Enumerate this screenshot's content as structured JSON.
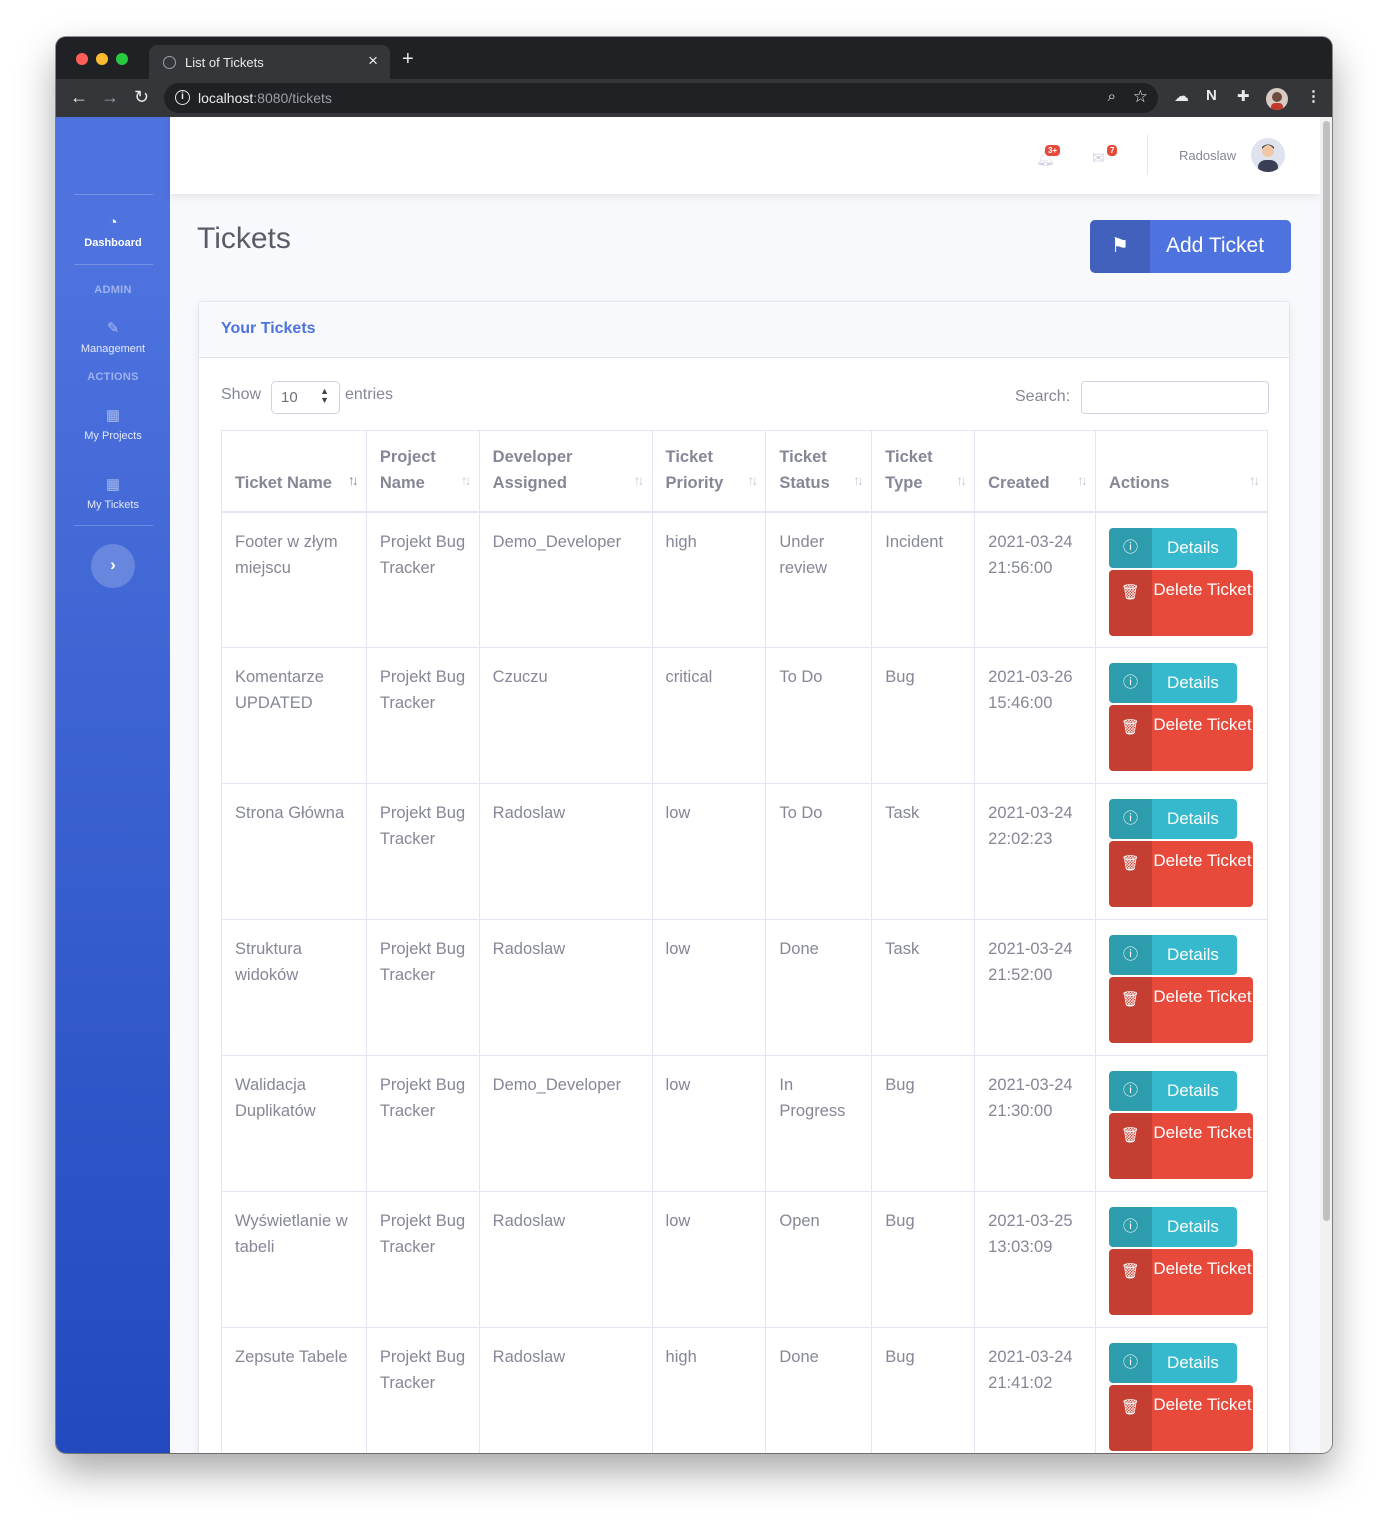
{
  "browser": {
    "tab_title": "List of Tickets",
    "url_host": "localhost",
    "url_path": ":8080/tickets"
  },
  "sidebar": {
    "dashboard": "Dashboard",
    "heading_admin": "ADMIN",
    "management": "Management",
    "heading_actions": "ACTIONS",
    "my_projects": "My Projects",
    "my_tickets": "My Tickets"
  },
  "topbar": {
    "alerts_count": "3+",
    "messages_count": "7",
    "user_name": "Radoslaw"
  },
  "page": {
    "title": "Tickets",
    "add_button": "Add Ticket"
  },
  "card": {
    "header": "Your Tickets",
    "show_label": "Show",
    "entries_value": "10",
    "entries_label": "entries",
    "search_label": "Search:"
  },
  "table": {
    "columns": [
      "Ticket Name",
      "Project Name",
      "Developer Assigned",
      "Ticket Priority",
      "Ticket Status",
      "Ticket Type",
      "Created",
      "Actions"
    ],
    "details_label": "Details",
    "delete_label": "Delete Ticket",
    "rows": [
      {
        "name": "Footer w złym miejscu",
        "project": "Projekt Bug Tracker",
        "developer": "Demo_Developer",
        "priority": "high",
        "status": "Under review",
        "type": "Incident",
        "created": "2021-03-24 21:56:00"
      },
      {
        "name": "Komentarze UPDATED",
        "project": "Projekt Bug Tracker",
        "developer": "Czuczu",
        "priority": "critical",
        "status": "To Do",
        "type": "Bug",
        "created": "2021-03-26 15:46:00"
      },
      {
        "name": "Strona Główna",
        "project": "Projekt Bug Tracker",
        "developer": "Radoslaw",
        "priority": "low",
        "status": "To Do",
        "type": "Task",
        "created": "2021-03-24 22:02:23"
      },
      {
        "name": "Struktura widoków",
        "project": "Projekt Bug Tracker",
        "developer": "Radoslaw",
        "priority": "low",
        "status": "Done",
        "type": "Task",
        "created": "2021-03-24 21:52:00"
      },
      {
        "name": "Walidacja Duplikatów",
        "project": "Projekt Bug Tracker",
        "developer": "Demo_Developer",
        "priority": "low",
        "status": "In Progress",
        "type": "Bug",
        "created": "2021-03-24 21:30:00"
      },
      {
        "name": "Wyświetlanie w tabeli",
        "project": "Projekt Bug Tracker",
        "developer": "Radoslaw",
        "priority": "low",
        "status": "Open",
        "type": "Bug",
        "created": "2021-03-25 13:03:09"
      },
      {
        "name": "Zepsute Tabele",
        "project": "Projekt Bug Tracker",
        "developer": "Radoslaw",
        "priority": "high",
        "status": "Done",
        "type": "Bug",
        "created": "2021-03-24 21:41:02"
      }
    ]
  },
  "colors": {
    "primary": "#4e73df",
    "info": "#36b9cc",
    "danger": "#e74a3b",
    "text": "#858796"
  }
}
